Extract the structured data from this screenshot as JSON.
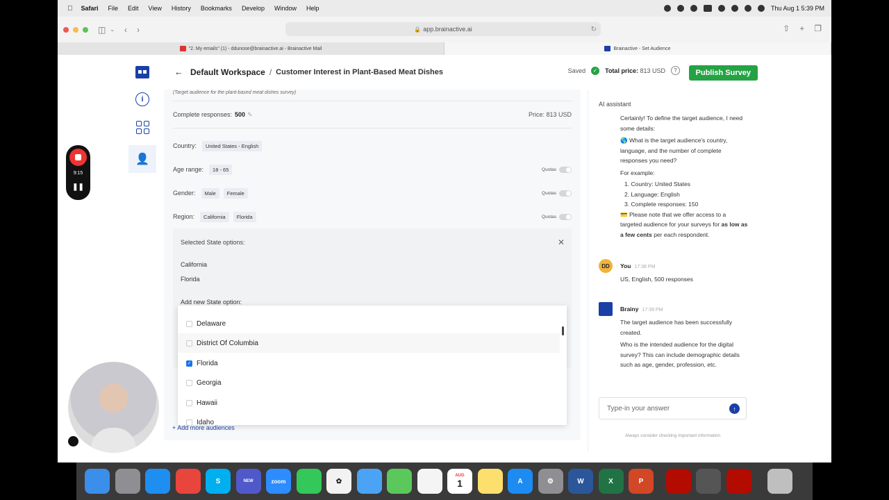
{
  "menubar": {
    "app": "Safari",
    "items": [
      "File",
      "Edit",
      "View",
      "History",
      "Bookmarks",
      "Develop",
      "Window",
      "Help"
    ],
    "clock": "Thu Aug 1  5:39 PM"
  },
  "browser": {
    "url": "app.brainactive.ai",
    "tabs": [
      {
        "label": "\"2. My emails\" (1) - ddunose@brainactive.ai - Brainactive Mail",
        "icon": "gmail-icon"
      },
      {
        "label": "Brainactive - Set Audience",
        "icon": "brainactive-icon"
      }
    ]
  },
  "header": {
    "workspace": "Default Workspace",
    "separator": "/",
    "survey_title": "Customer Interest in Plant-Based Meat Dishes",
    "saved": "Saved",
    "total_price_label": "Total price:",
    "total_price_value": "813 USD",
    "publish_label": "Publish Survey"
  },
  "audience": {
    "subtitle": "(Target audience for the plant-based meat dishes survey)",
    "complete_responses_label": "Complete responses:",
    "complete_responses_value": "500",
    "price": "Price: 813 USD",
    "country_label": "Country:",
    "country_value": "United States - English",
    "age_label": "Age range:",
    "age_value": "18 - 65",
    "gender_label": "Gender:",
    "gender_values": [
      "Male",
      "Female"
    ],
    "region_label": "Region:",
    "region_values": [
      "California",
      "Florida"
    ],
    "quotas_label": "Quotas"
  },
  "state_panel": {
    "selected_label": "Selected State options:",
    "selected": [
      "California",
      "Florida"
    ],
    "add_label": "Add new State option:"
  },
  "state_dropdown": {
    "items": [
      {
        "label": "Delaware",
        "checked": false
      },
      {
        "label": "District Of Columbia",
        "checked": false
      },
      {
        "label": "Florida",
        "checked": true
      },
      {
        "label": "Georgia",
        "checked": false
      },
      {
        "label": "Hawaii",
        "checked": false
      },
      {
        "label": "Idaho",
        "checked": false
      }
    ]
  },
  "add_audiences": "+ Add more audiences",
  "ai": {
    "title": "AI assistant",
    "intro": [
      "Certainly! To define the target audience, I need some details:",
      "🌎 What is the target audience's country, language, and the number of complete responses you need?",
      "For example:",
      "1. Country: United States",
      "2. Language: English",
      "3. Complete responses: 150"
    ],
    "note_prefix": "💳 Please note that we offer access to a targeted audience for your surveys for ",
    "note_bold": "as low as a few cents",
    "note_suffix": " per each respondent.",
    "user_msg": {
      "initials": "DD",
      "name": "You",
      "time": "17:38 PM",
      "text": "US, English, 500 responses"
    },
    "bot_msg": {
      "name": "Brainy",
      "time": "17:39 PM",
      "text1": "The target audience has been successfully created.",
      "text2": "Who is the intended audience for the digital survey? This can include demographic details such as age, gender, profession, etc."
    },
    "input_placeholder": "Type-in your answer",
    "footer": "Always consider checking important information"
  },
  "recorder": {
    "time": "9:15"
  },
  "dock": [
    "finder-icon",
    "launchpad-icon",
    "safari-icon",
    "chrome-icon",
    "skype-icon",
    "teams-icon",
    "zoom-icon",
    "messages-icon",
    "chatgpt-icon",
    "mail-icon",
    "maps-icon",
    "photos-icon",
    "calendar-icon",
    "notes-icon",
    "appstore-icon",
    "settings-icon",
    "word-icon",
    "excel-icon",
    "powerpoint-icon",
    "acrobat-icon",
    "calculator-icon",
    "acrobat-reader-icon",
    "trash-icon"
  ],
  "dock_labels": {
    "zoom": "zoom",
    "calendar_month": "AUG",
    "calendar_day": "1",
    "teams_badge": "NEW"
  }
}
